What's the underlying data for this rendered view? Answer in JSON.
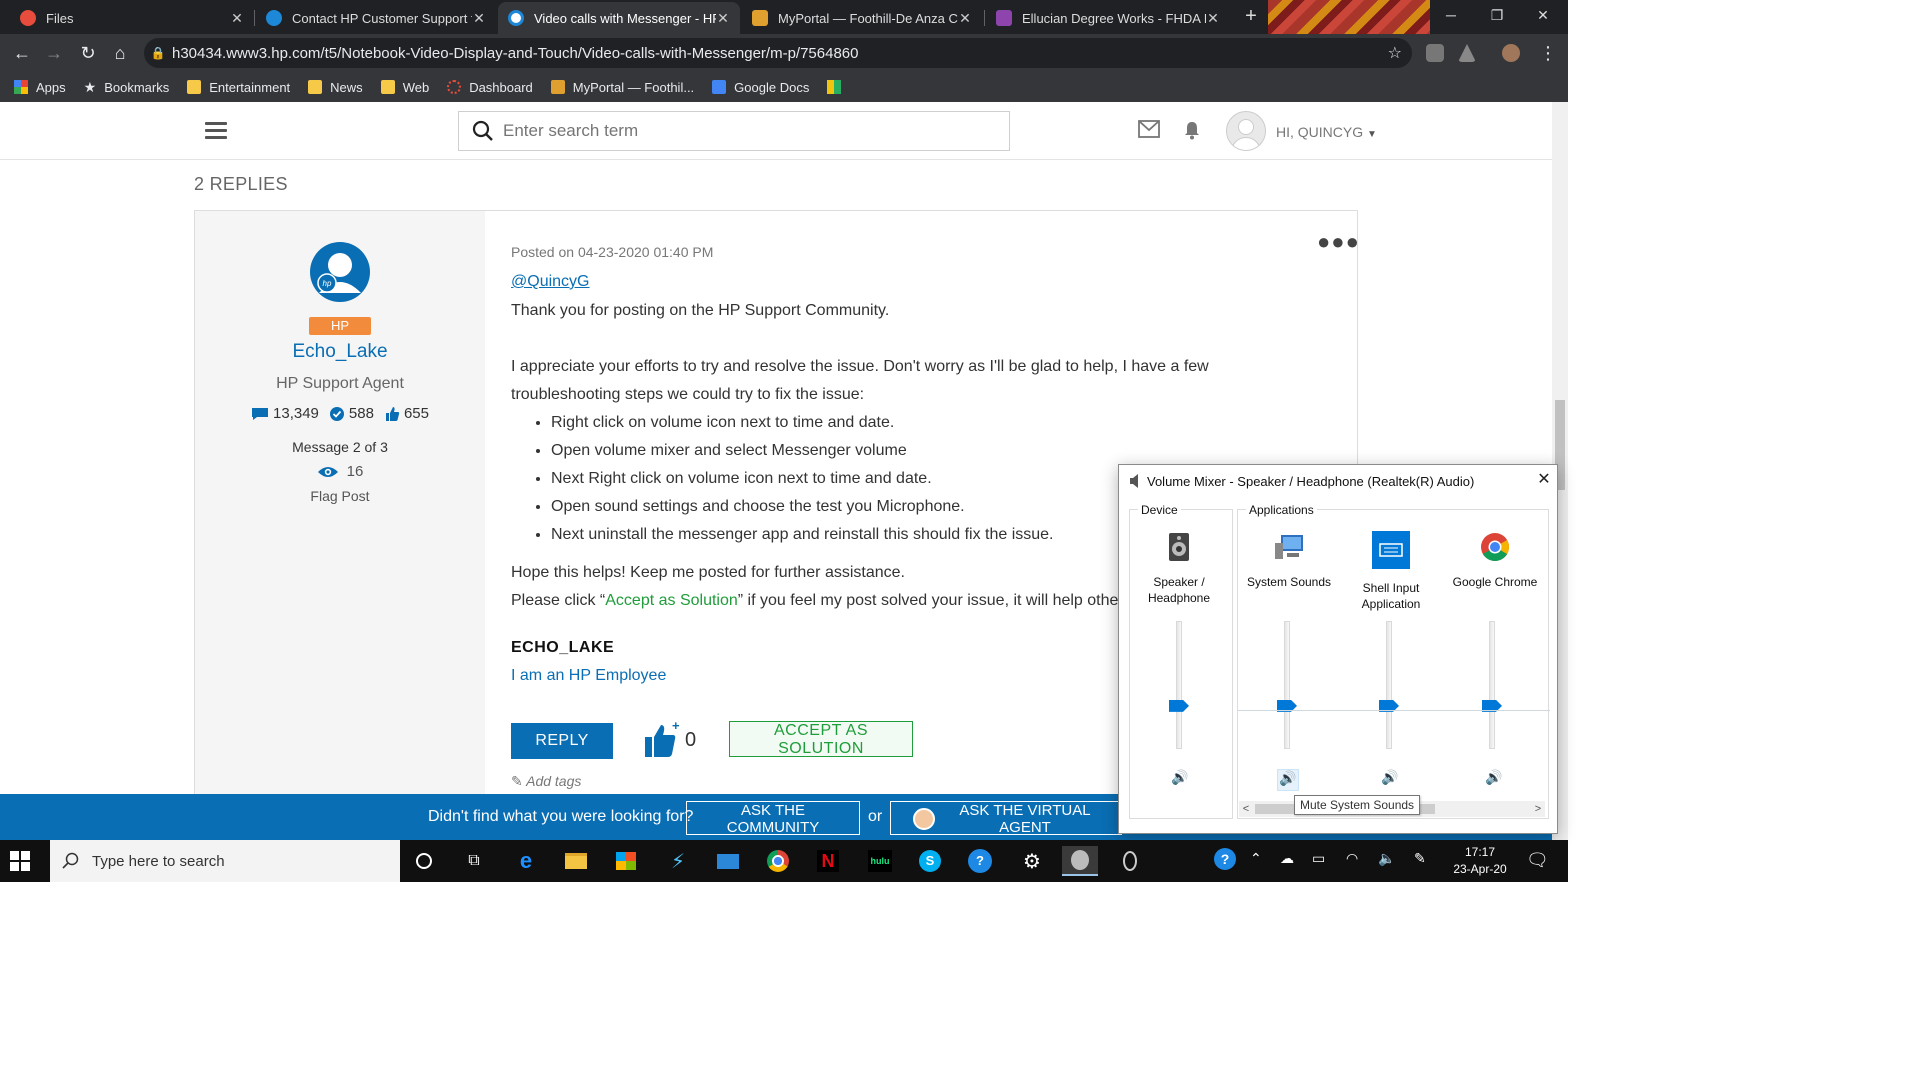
{
  "browser": {
    "tabs": [
      {
        "title": "Files",
        "active": false
      },
      {
        "title": "Contact HP Customer Support fo",
        "active": false
      },
      {
        "title": "Video calls with Messenger - HP",
        "active": true
      },
      {
        "title": "MyPortal — Foothill-De Anza Co",
        "active": false
      },
      {
        "title": "Ellucian Degree Works - FHDA D",
        "active": false
      }
    ],
    "url": "h30434.www3.hp.com/t5/Notebook-Video-Display-and-Touch/Video-calls-with-Messenger/m-p/7564860",
    "bookmarks": [
      "Apps",
      "Bookmarks",
      "Entertainment",
      "News",
      "Web",
      "Dashboard",
      "MyPortal — Foothil...",
      "Google Docs"
    ]
  },
  "site": {
    "search_placeholder": "Enter search term",
    "greeting": "HI, QUINCYG"
  },
  "thread": {
    "replies_heading": "2 REPLIES"
  },
  "post": {
    "author": {
      "badge": "HP",
      "name": "Echo_Lake",
      "role": "HP Support Agent",
      "messages": "13,349",
      "solutions": "588",
      "kudos": "655",
      "message_index": "Message 2 of 3",
      "views": "16",
      "flag": "Flag Post"
    },
    "posted": "Posted on 04-23-2020 01:40 PM",
    "mention": "@QuincyG",
    "line1": "Thank you for posting on the HP Support Community.",
    "line2": "I appreciate your efforts to try and resolve the issue. Don't worry as I'll be glad to help, I have a few",
    "line3": "troubleshooting steps we could try to fix the issue:",
    "steps": [
      "Right click on volume icon next to time and date.",
      "Open volume mixer and select Messenger volume",
      "Next Right click on volume icon next to time and date.",
      "Open sound settings and choose the test you Microphone.",
      "Next uninstall the messenger app and reinstall this should fix the issue."
    ],
    "closing": "Hope this helps! Keep me posted for further assistance.",
    "accept_prefix": "Please click “",
    "accept_link": "Accept as Solution",
    "accept_suffix": "” if you feel my post solved your issue, it will help others fi",
    "sig_name": "ECHO_LAKE",
    "sig_employee": "I am an HP Employee",
    "reply_label": "REPLY",
    "kudo_count": "0",
    "accept_button": "ACCEPT AS SOLUTION",
    "add_tags": "Add tags"
  },
  "help_bar": {
    "text": "Didn't find what you were looking for?",
    "community_button": "ASK THE COMMUNITY",
    "or": "or",
    "agent_button": "ASK THE VIRTUAL AGENT"
  },
  "mixer": {
    "title": "Volume Mixer - Speaker / Headphone (Realtek(R) Audio)",
    "device_group": "Device",
    "apps_group": "Applications",
    "channels": [
      {
        "label_line1": "Speaker /",
        "label_line2": "Headphone",
        "level": 0.32
      },
      {
        "label_line1": "System Sounds",
        "label_line2": "",
        "level": 0.32
      },
      {
        "label_line1": "Shell Input",
        "label_line2": "Application",
        "level": 0.32
      },
      {
        "label_line1": "Google Chrome",
        "label_line2": "",
        "level": 0.32
      }
    ],
    "tooltip": "Mute System Sounds"
  },
  "taskbar": {
    "search_placeholder": "Type here to search",
    "time": "17:17",
    "date": "23-Apr-20"
  },
  "colors": {
    "hp_blue": "#0a6eb4",
    "accept_green": "#1f9d3a",
    "badge_orange": "#f28c3c",
    "win_blue": "#0078d7"
  }
}
